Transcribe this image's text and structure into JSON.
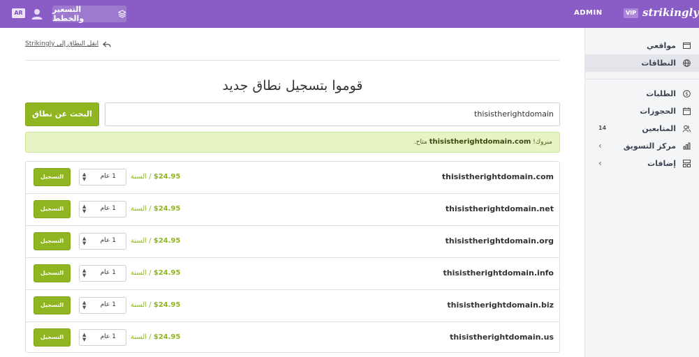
{
  "topbar": {
    "lang": "AR",
    "pricing_label": "التسعير والخطط",
    "admin_label": "ADMIN",
    "vip_label": "VIP",
    "logo_text": "strikingly",
    "bg_color": "#8a5cc5"
  },
  "sidebar": {
    "items": [
      {
        "label": "مواقعي",
        "icon": "browser-icon",
        "active": false
      },
      {
        "label": "النطاقات",
        "icon": "globe-icon",
        "active": true
      },
      {
        "label": "الطلبات",
        "icon": "dollar-circle-icon",
        "active": false
      },
      {
        "label": "الحجوزات",
        "icon": "calendar-icon",
        "active": false
      },
      {
        "label": "المتابعين",
        "icon": "users-icon",
        "count": "14",
        "active": false
      },
      {
        "label": "مركز التسويق",
        "icon": "bar-chart-icon",
        "active": false
      },
      {
        "label": "إضافات",
        "icon": "apps-icon",
        "active": false
      }
    ]
  },
  "main": {
    "back_link": "انقل النطاق إلى Strikingly",
    "title": "قوموا بتسجيل نطاق جديد",
    "search_value": "thisistherightdomain",
    "search_button": "البحث عن نطاق",
    "alert": {
      "prefix": "مبروك!",
      "domain": "thisistherightdomain.com",
      "suffix": "متاح."
    },
    "domains": [
      {
        "name": "thisistherightdomain.com",
        "price": "$24.95",
        "per": "/ السنة",
        "period": "1 عام",
        "button": "التسجيل"
      },
      {
        "name": "thisistherightdomain.net",
        "price": "$24.95",
        "per": "/ السنة",
        "period": "1 عام",
        "button": "التسجيل"
      },
      {
        "name": "thisistherightdomain.org",
        "price": "$24.95",
        "per": "/ السنة",
        "period": "1 عام",
        "button": "التسجيل"
      },
      {
        "name": "thisistherightdomain.info",
        "price": "$24.95",
        "per": "/ السنة",
        "period": "1 عام",
        "button": "التسجيل"
      },
      {
        "name": "thisistherightdomain.biz",
        "price": "$24.95",
        "per": "/ السنة",
        "period": "1 عام",
        "button": "التسجيل"
      },
      {
        "name": "thisistherightdomain.us",
        "price": "$24.95",
        "per": "/ السنة",
        "period": "1 عام",
        "button": "التسجيل"
      }
    ],
    "accent_color": "#8fb520"
  }
}
